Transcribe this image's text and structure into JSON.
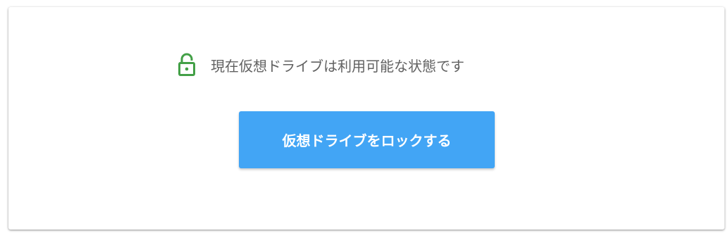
{
  "status": {
    "icon": "unlocked-padlock-icon",
    "icon_color": "#43a047",
    "text": "現在仮想ドライブは利用可能な状態です"
  },
  "actions": {
    "lock_button_label": "仮想ドライブをロックする",
    "lock_button_color": "#42a5f5"
  }
}
